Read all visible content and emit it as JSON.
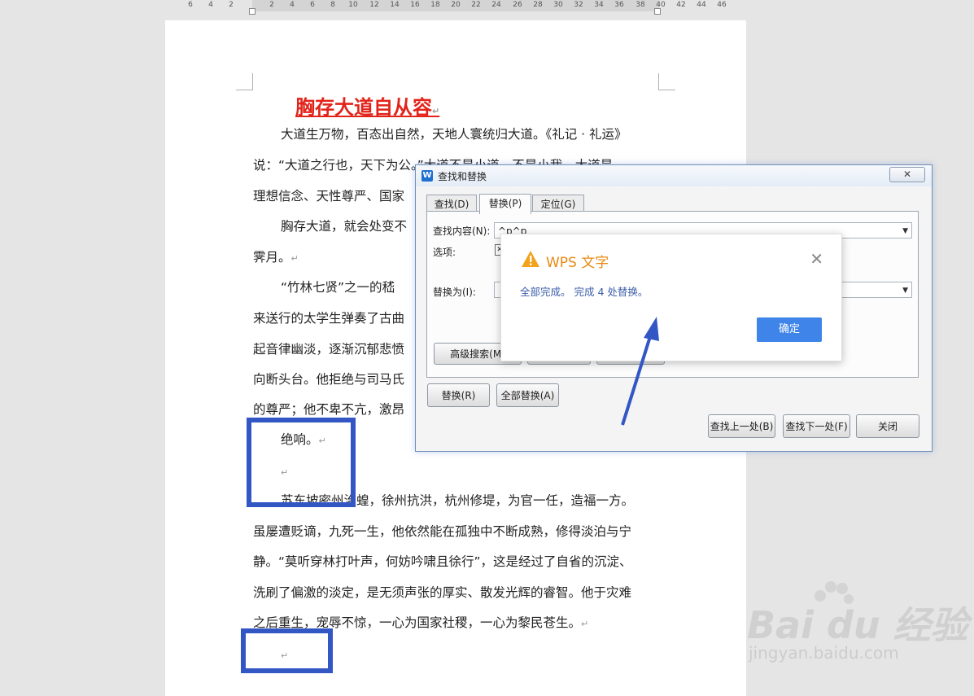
{
  "ruler": {
    "ticks": [
      "6",
      "4",
      "2",
      "2",
      "4",
      "6",
      "8",
      "10",
      "12",
      "14",
      "16",
      "18",
      "20",
      "22",
      "24",
      "26",
      "28",
      "30",
      "32",
      "34",
      "36",
      "38",
      "40",
      "42",
      "44",
      "46"
    ]
  },
  "document": {
    "title": "胸存大道自从容",
    "return_mark": "↵",
    "lines": [
      "大道生万物，百态出自然，天地人寰统归大道。《礼记 · 礼运》",
      "说：“大道之行也，天下为公。”大道不是小道，不是小我，大道是",
      "理想信念、天性尊严、国家",
      "胸存大道，就会处变不",
      "霁月。",
      "“竹林七贤”之一的嵇",
      "来送行的太学生弹奏了古曲",
      "起音律幽淡，逐渐沉郁悲愤",
      "向断头台。他拒绝与司马氏",
      "的尊严；他不卑不亢，激昂",
      "绝响。",
      "",
      "苏东坡密州治蝗，徐州抗洪，杭州修堤，为官一任，造福一方。",
      "虽屡遭贬谪，九死一生，他依然能在孤独中不断成熟，修得淡泊与宁",
      "静。“莫听穿林打叶声，何妨吟啸且徐行”，这是经过了自省的沉淀、",
      "洗刷了偏激的淡定，是无须声张的厚实、散发光辉的睿智。他于灾难",
      "之后重生，宠辱不惊，一心为国家社稷，一心为黎民苍生。",
      ""
    ]
  },
  "find_replace_dialog": {
    "logo": "W",
    "title": "查找和替换",
    "close_label": "✕",
    "tabs": [
      "查找(D)",
      "替换(P)",
      "定位(G)"
    ],
    "find_label": "查找内容(N):",
    "find_value": "^p^p",
    "options_label": "选项:",
    "replace_label": "替换为(I):",
    "advanced_button": "高级搜索(M)",
    "replace_button": "替换(R)",
    "replace_all_button": "全部替换(A)",
    "find_prev_button": "查找上一处(B)",
    "find_next_button": "查找下一处(F)",
    "close_button": "关闭"
  },
  "message_box": {
    "title": "WPS 文字",
    "text": "全部完成。 完成 4 处替换。",
    "ok_button": "确定",
    "close_label": "✕"
  },
  "watermark": {
    "text": "Bai du 经验",
    "url": "jingyan.baidu.com"
  },
  "colors": {
    "title_red": "#e2231a",
    "highlight_blue": "#3256c4",
    "ok_blue": "#3f84e8",
    "warning_orange": "#e88a12"
  }
}
